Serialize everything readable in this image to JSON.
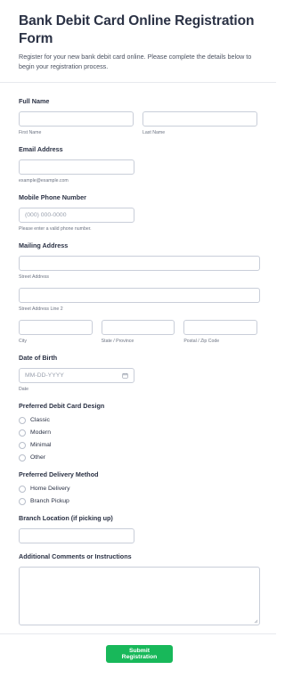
{
  "header": {
    "title": "Bank Debit Card Online Registration Form",
    "subtitle": "Register for your new bank debit card online. Please complete the details below to begin your registration process."
  },
  "full_name": {
    "label": "Full Name",
    "first_sublabel": "First Name",
    "last_sublabel": "Last Name",
    "first_value": "",
    "last_value": ""
  },
  "email": {
    "label": "Email Address",
    "value": "",
    "sublabel": "example@example.com"
  },
  "phone": {
    "label": "Mobile Phone Number",
    "placeholder": "(000) 000-0000",
    "sublabel": "Please enter a valid phone number."
  },
  "address": {
    "label": "Mailing Address",
    "street_sublabel": "Street Address",
    "street2_sublabel": "Street Address Line 2",
    "city_sublabel": "City",
    "state_sublabel": "State / Province",
    "zip_sublabel": "Postal / Zip Code"
  },
  "dob": {
    "label": "Date of Birth",
    "placeholder": "MM-DD-YYYY",
    "sublabel": "Date",
    "icon": "calendar-icon"
  },
  "card_design": {
    "label": "Preferred Debit Card Design",
    "options": [
      "Classic",
      "Modern",
      "Minimal",
      "Other"
    ]
  },
  "delivery": {
    "label": "Preferred Delivery Method",
    "options": [
      "Home Delivery",
      "Branch Pickup"
    ]
  },
  "branch": {
    "label": "Branch Location (if picking up)",
    "value": ""
  },
  "comments": {
    "label": "Additional Comments or Instructions",
    "value": ""
  },
  "submit_label": "Submit Registration",
  "colors": {
    "accent": "#18b85a",
    "title": "#2b3245",
    "border": "#c9ced9"
  }
}
